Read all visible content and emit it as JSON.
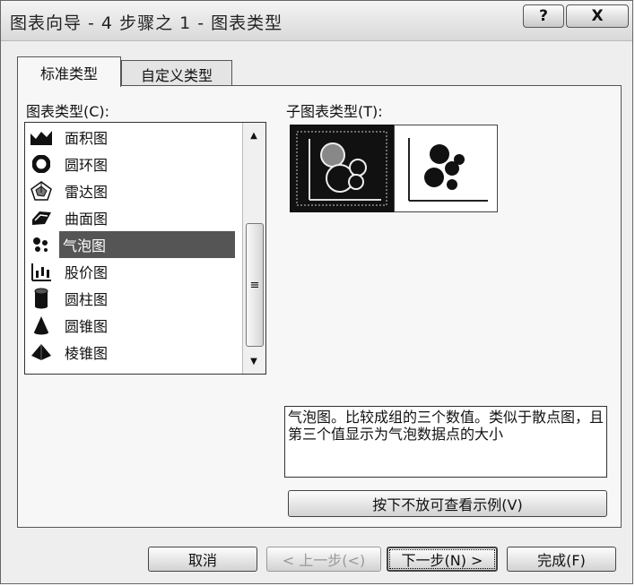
{
  "window": {
    "title": "图表向导 - 4 步骤之 1 - 图表类型",
    "help_button": "?",
    "close_button": "X"
  },
  "tabs": [
    {
      "label": "标准类型",
      "active": true
    },
    {
      "label": "自定义类型",
      "active": false
    }
  ],
  "chart_type": {
    "label": "图表类型(C):",
    "items": [
      {
        "label": "面积图",
        "icon": "area-chart-icon"
      },
      {
        "label": "圆环图",
        "icon": "doughnut-chart-icon"
      },
      {
        "label": "雷达图",
        "icon": "radar-chart-icon"
      },
      {
        "label": "曲面图",
        "icon": "surface-chart-icon"
      },
      {
        "label": "气泡图",
        "icon": "bubble-chart-icon",
        "selected": true
      },
      {
        "label": "股价图",
        "icon": "stock-chart-icon"
      },
      {
        "label": "圆柱图",
        "icon": "cylinder-chart-icon"
      },
      {
        "label": "圆锥图",
        "icon": "cone-chart-icon"
      },
      {
        "label": "棱锥图",
        "icon": "pyramid-chart-icon"
      }
    ]
  },
  "sub_type": {
    "label": "子图表类型(T):",
    "options": [
      {
        "icon": "bubble-subtype-icon",
        "selected": true
      },
      {
        "icon": "3d-bubble-subtype-icon",
        "selected": false
      }
    ]
  },
  "description": "气泡图。比较成组的三个数值。类似于散点图，且第三个值显示为气泡数据点的大小",
  "preview_button": "按下不放可查看示例(V)",
  "buttons": {
    "cancel": "取消",
    "back": "< 上一步(<)",
    "next": "下一步(N) >",
    "finish": "完成(F)"
  }
}
